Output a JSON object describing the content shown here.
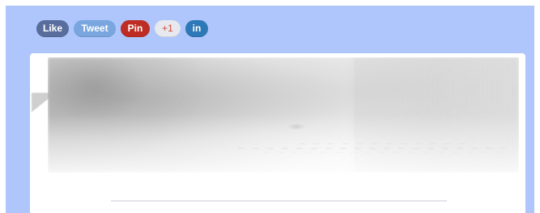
{
  "share_bar": {
    "like": "Like",
    "tweet": "Tweet",
    "pin": "Pin",
    "plus_one": "+1",
    "linkedin": "in"
  },
  "colors": {
    "background_panel": "#aec6fb",
    "like": "#596d9d",
    "tweet": "#7aa6df",
    "pin": "#bd2d23",
    "plus_one_bg": "#e8e8ef",
    "plus_one_text": "#d14a3a",
    "linkedin": "#2d78b6"
  },
  "content": {
    "hero_image": {
      "icon": "blurred-hero-image"
    },
    "divider": {
      "icon": "horizontal-divider"
    }
  }
}
